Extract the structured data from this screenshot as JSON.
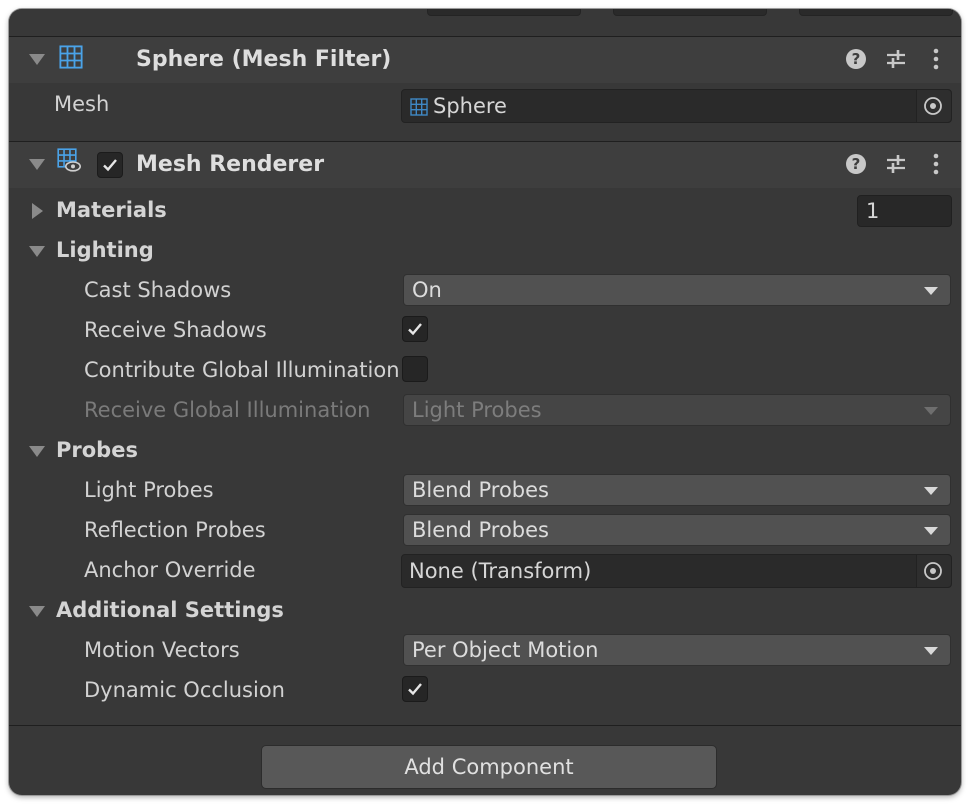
{
  "mesh_filter": {
    "title": "Sphere (Mesh Filter)",
    "mesh_label": "Mesh",
    "mesh_value": "Sphere"
  },
  "mesh_renderer": {
    "title": "Mesh Renderer",
    "enabled": true,
    "materials": {
      "label": "Materials",
      "count": "1"
    },
    "lighting": {
      "label": "Lighting",
      "cast_shadows_label": "Cast Shadows",
      "cast_shadows_value": "On",
      "receive_shadows_label": "Receive Shadows",
      "receive_shadows_checked": true,
      "contribute_gi_label": "Contribute Global Illumination",
      "contribute_gi_checked": false,
      "receive_gi_label": "Receive Global Illumination",
      "receive_gi_value": "Light Probes"
    },
    "probes": {
      "label": "Probes",
      "light_probes_label": "Light Probes",
      "light_probes_value": "Blend Probes",
      "reflection_probes_label": "Reflection Probes",
      "reflection_probes_value": "Blend Probes",
      "anchor_override_label": "Anchor Override",
      "anchor_override_value": "None (Transform)"
    },
    "additional": {
      "label": "Additional Settings",
      "motion_vectors_label": "Motion Vectors",
      "motion_vectors_value": "Per Object Motion",
      "dynamic_occlusion_label": "Dynamic Occlusion",
      "dynamic_occlusion_checked": true
    }
  },
  "footer": {
    "add_component_label": "Add Component"
  },
  "icons": {
    "mesh_filter": "mesh-grid-icon",
    "mesh_renderer": "mesh-renderer-icon",
    "help": "help-icon",
    "presets": "presets-sliders-icon",
    "menu": "kebab-menu-icon",
    "picker": "object-picker-icon"
  },
  "colors": {
    "panel": "#383838",
    "header": "#3e3e3e",
    "accent_icon": "#4aa3e8"
  }
}
